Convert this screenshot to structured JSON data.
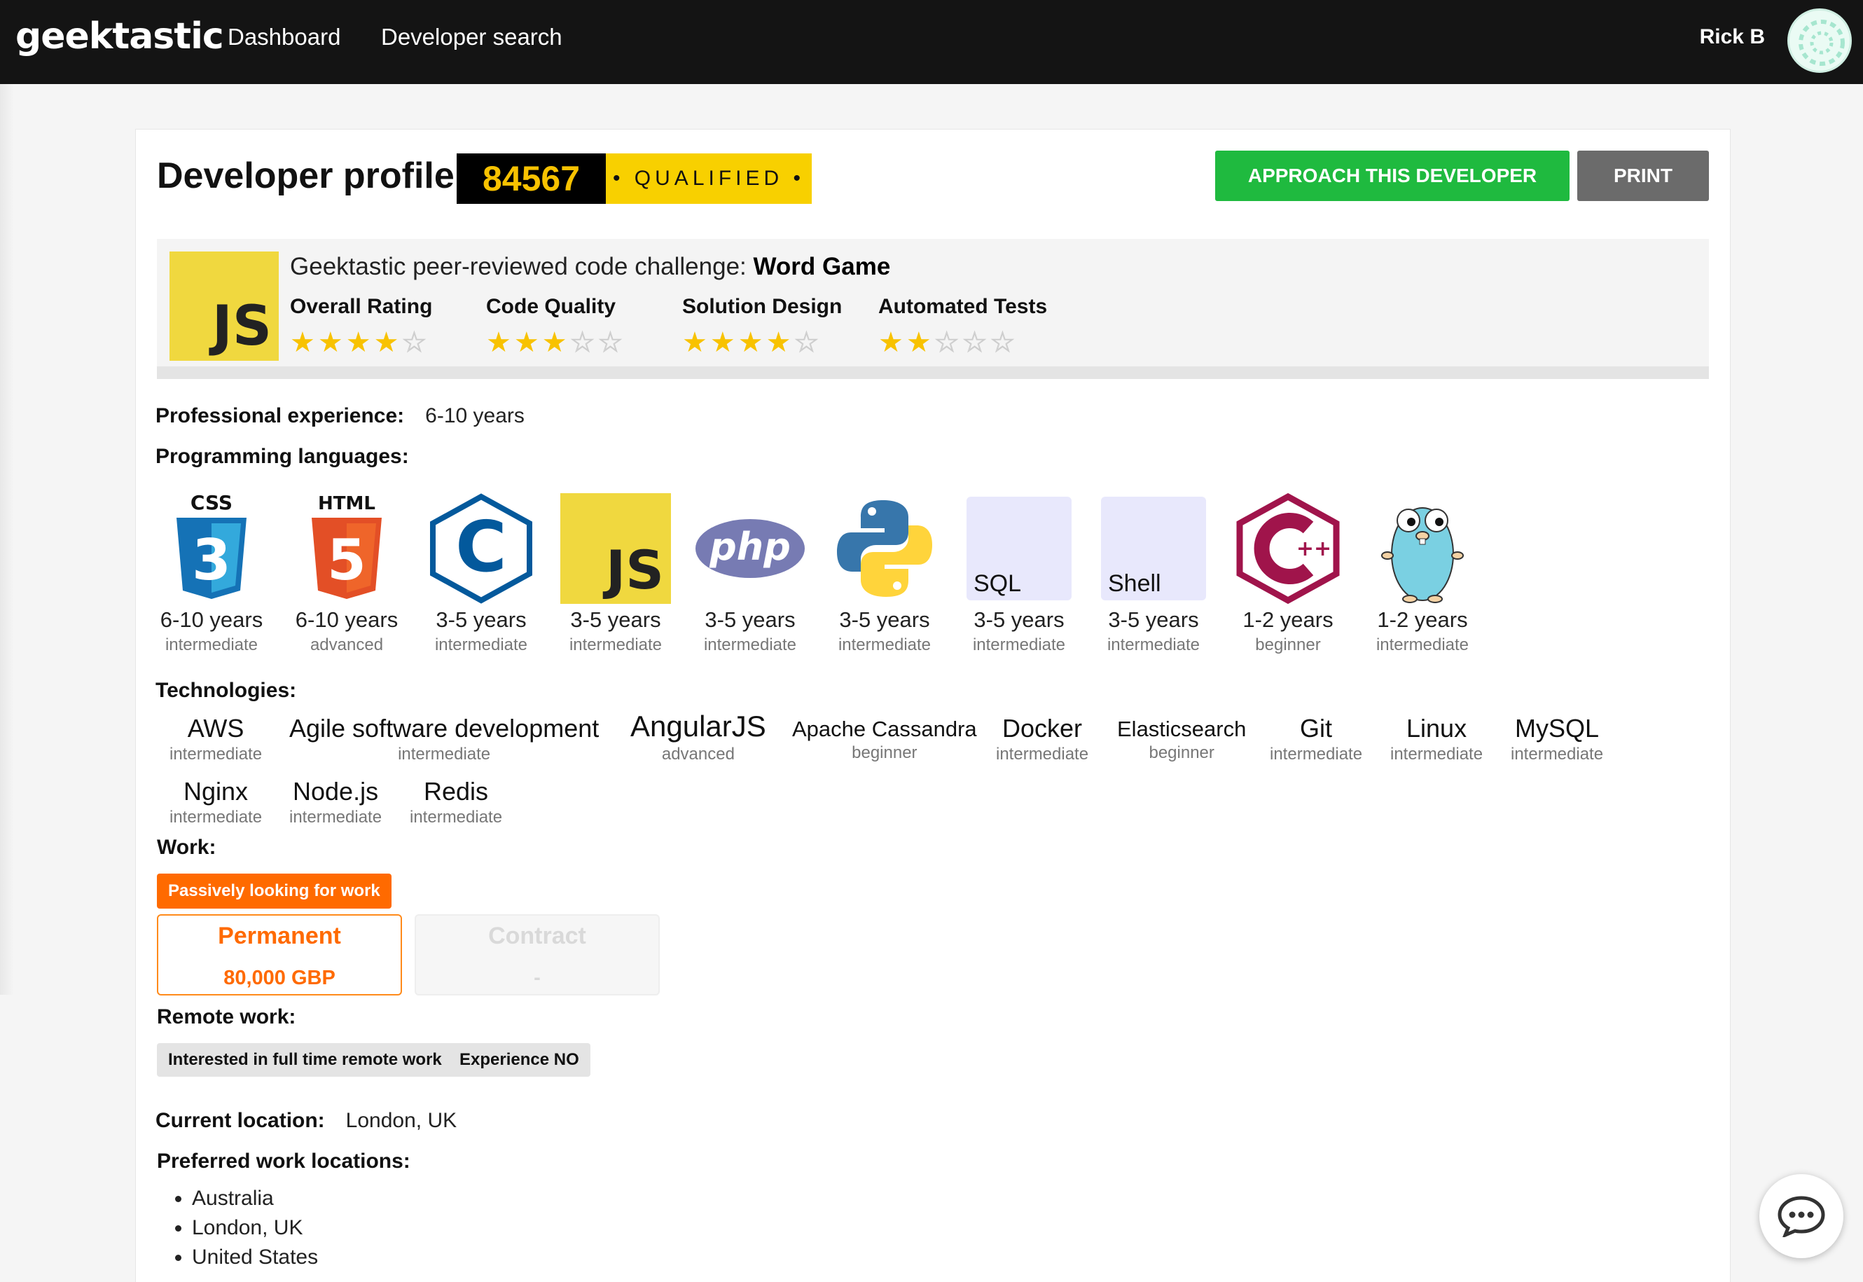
{
  "nav": {
    "logo": "geektastic",
    "links": [
      "Dashboard",
      "Developer search"
    ],
    "user_name": "Rick B"
  },
  "profile": {
    "title": "Developer profile:",
    "id": "84567",
    "status": "• QUALIFIED •",
    "approach_label": "APPROACH THIS DEVELOPER",
    "print_label": "PRINT"
  },
  "challenge": {
    "logo_text": "JS",
    "prefix": "Geektastic peer-reviewed code challenge:",
    "name": "Word Game",
    "metrics": [
      {
        "label": "Overall Rating",
        "stars": 4,
        "max": 5
      },
      {
        "label": "Code Quality",
        "stars": 3,
        "max": 5
      },
      {
        "label": "Solution Design",
        "stars": 4,
        "max": 5
      },
      {
        "label": "Automated Tests",
        "stars": 2,
        "max": 5
      }
    ]
  },
  "experience": {
    "label": "Professional experience:",
    "value": "6-10 years"
  },
  "languages": {
    "label": "Programming languages:",
    "items": [
      {
        "icon": "css3-icon",
        "caption": "CSS",
        "years": "6-10 years",
        "level": "intermediate"
      },
      {
        "icon": "html5-icon",
        "caption": "HTML",
        "years": "6-10 years",
        "level": "advanced"
      },
      {
        "icon": "c-icon",
        "caption": "C",
        "years": "3-5 years",
        "level": "intermediate"
      },
      {
        "icon": "javascript-icon",
        "caption": "JS",
        "years": "3-5 years",
        "level": "intermediate"
      },
      {
        "icon": "php-icon",
        "caption": "php",
        "years": "3-5 years",
        "level": "intermediate"
      },
      {
        "icon": "python-icon",
        "caption": "",
        "years": "3-5 years",
        "level": "intermediate"
      },
      {
        "icon": "sql-icon",
        "caption": "SQL",
        "years": "3-5 years",
        "level": "intermediate"
      },
      {
        "icon": "shell-icon",
        "caption": "Shell",
        "years": "3-5 years",
        "level": "intermediate"
      },
      {
        "icon": "cpp-icon",
        "caption": "++",
        "years": "1-2 years",
        "level": "beginner"
      },
      {
        "icon": "go-gopher-icon",
        "caption": "",
        "years": "1-2 years",
        "level": "intermediate"
      }
    ]
  },
  "technologies": {
    "label": "Technologies:",
    "items": [
      {
        "name": "AWS",
        "level": "intermediate"
      },
      {
        "name": "Agile software development",
        "level": "intermediate"
      },
      {
        "name": "AngularJS",
        "level": "advanced"
      },
      {
        "name": "Apache Cassandra",
        "level": "beginner"
      },
      {
        "name": "Docker",
        "level": "intermediate"
      },
      {
        "name": "Elasticsearch",
        "level": "beginner"
      },
      {
        "name": "Git",
        "level": "intermediate"
      },
      {
        "name": "Linux",
        "level": "intermediate"
      },
      {
        "name": "MySQL",
        "level": "intermediate"
      },
      {
        "name": "Nginx",
        "level": "intermediate"
      },
      {
        "name": "Node.js",
        "level": "intermediate"
      },
      {
        "name": "Redis",
        "level": "intermediate"
      }
    ]
  },
  "work": {
    "label": "Work:",
    "status": "Passively looking for work",
    "permanent": {
      "title": "Permanent",
      "value": "80,000 GBP"
    },
    "contract": {
      "title": "Contract",
      "value": "-"
    }
  },
  "remote": {
    "label": "Remote work:",
    "tags": [
      "Interested in full time remote work",
      "Experience NO"
    ]
  },
  "location": {
    "label": "Current location:",
    "value": "London, UK"
  },
  "preferred": {
    "label": "Preferred work locations:",
    "items": [
      "Australia",
      "London, UK",
      "United States"
    ]
  },
  "colors": {
    "topbar": "#141414",
    "approach": "#1fba3f",
    "print": "#6b6b6b",
    "badge_yellow": "#f8d000",
    "star": "#f8c200",
    "work_orange": "#ff6a00"
  }
}
